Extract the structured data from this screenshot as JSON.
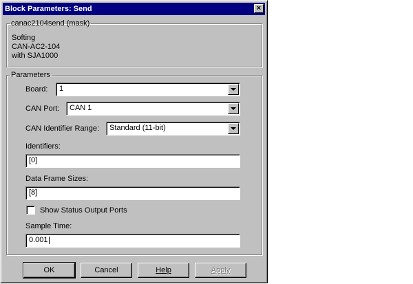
{
  "window": {
    "title": "Block Parameters: Send",
    "close_glyph": "×"
  },
  "mask": {
    "legend": "canac2104send (mask)",
    "desc_lines": [
      "Softing",
      "CAN-AC2-104",
      "with SJA1000"
    ]
  },
  "params": {
    "legend": "Parameters",
    "board": {
      "label": "Board:",
      "value": "1"
    },
    "can_port": {
      "label": "CAN Port:",
      "value": "CAN 1"
    },
    "id_range": {
      "label": "CAN Identifier Range:",
      "value": "Standard (11-bit)"
    },
    "identifiers": {
      "label": "Identifiers:",
      "value": "[0]"
    },
    "frame_sizes": {
      "label": "Data Frame Sizes:",
      "value": "[8]"
    },
    "status_ports": {
      "label": "Show Status Output Ports",
      "checked": false
    },
    "sample_time": {
      "label": "Sample Time:",
      "value": "0.001"
    }
  },
  "buttons": {
    "ok": "OK",
    "cancel": "Cancel",
    "help": "Help",
    "apply": "Apply"
  },
  "colors": {
    "title_bar": "#000080",
    "face": "#c0c0c0"
  }
}
